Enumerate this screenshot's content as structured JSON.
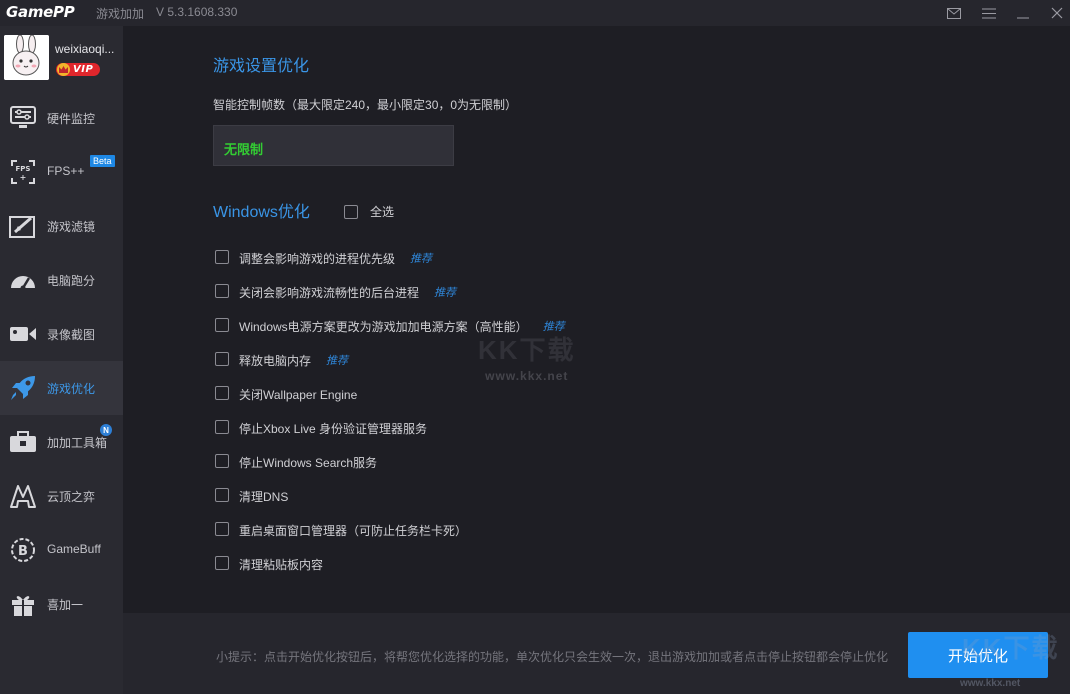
{
  "titlebar": {
    "logo": "GamePP",
    "app_name": "游戏加加",
    "version": "V 5.3.1608.330"
  },
  "profile": {
    "username": "weixiaoqi...",
    "vip_label": "VIP"
  },
  "sidebar": {
    "items": [
      {
        "label": "硬件监控",
        "icon": "hardware-monitor-icon",
        "active": false
      },
      {
        "label": "FPS++",
        "icon": "fps-icon",
        "badge": "Beta",
        "active": false
      },
      {
        "label": "游戏滤镜",
        "icon": "game-filter-icon",
        "active": false
      },
      {
        "label": "电脑跑分",
        "icon": "benchmark-icon",
        "active": false
      },
      {
        "label": "录像截图",
        "icon": "video-capture-icon",
        "active": false
      },
      {
        "label": "游戏优化",
        "icon": "rocket-icon",
        "active": true
      },
      {
        "label": "加加工具箱",
        "icon": "toolbox-icon",
        "badge": "N",
        "active": false
      },
      {
        "label": "云顶之弈",
        "icon": "tft-icon",
        "active": false
      },
      {
        "label": "GameBuff",
        "icon": "gamebuff-icon",
        "active": false
      },
      {
        "label": "喜加一",
        "icon": "gift-icon",
        "active": false
      }
    ]
  },
  "main": {
    "game_settings_title": "游戏设置优化",
    "fps_desc": "智能控制帧数（最大限定240，最小限定30，0为无限制）",
    "fps_value": "无限制",
    "windows_title": "Windows优化",
    "select_all_label": "全选",
    "options": [
      {
        "label": "调整会影响游戏的进程优先级",
        "tag": "推荐",
        "checked": false
      },
      {
        "label": "关闭会影响游戏流畅性的后台进程",
        "tag": "推荐",
        "checked": false
      },
      {
        "label": "Windows电源方案更改为游戏加加电源方案（高性能）",
        "tag": "推荐",
        "checked": false
      },
      {
        "label": "释放电脑内存",
        "tag": "推荐",
        "checked": false
      },
      {
        "label": "关闭Wallpaper Engine",
        "tag": "",
        "checked": false
      },
      {
        "label": "停止Xbox Live 身份验证管理器服务",
        "tag": "",
        "checked": false
      },
      {
        "label": "停止Windows Search服务",
        "tag": "",
        "checked": false
      },
      {
        "label": "清理DNS",
        "tag": "",
        "checked": false
      },
      {
        "label": "重启桌面窗口管理器（可防止任务栏卡死）",
        "tag": "",
        "checked": false
      },
      {
        "label": "清理粘贴板内容",
        "tag": "",
        "checked": false
      }
    ]
  },
  "footer": {
    "tip": "小提示：点击开始优化按钮后，将帮您优化选择的功能，单次优化只会生效一次，退出游戏加加或者点击停止按钮都会停止优化",
    "start_button": "开始优化"
  },
  "watermark": {
    "main": "KK下载",
    "sub": "www.kkx.net"
  },
  "colors": {
    "accent": "#1f8ff0",
    "title_blue": "#3a95e6",
    "fps_green": "#33cc33",
    "tag_blue": "#2f86d8",
    "vip_red": "#e0262c"
  }
}
